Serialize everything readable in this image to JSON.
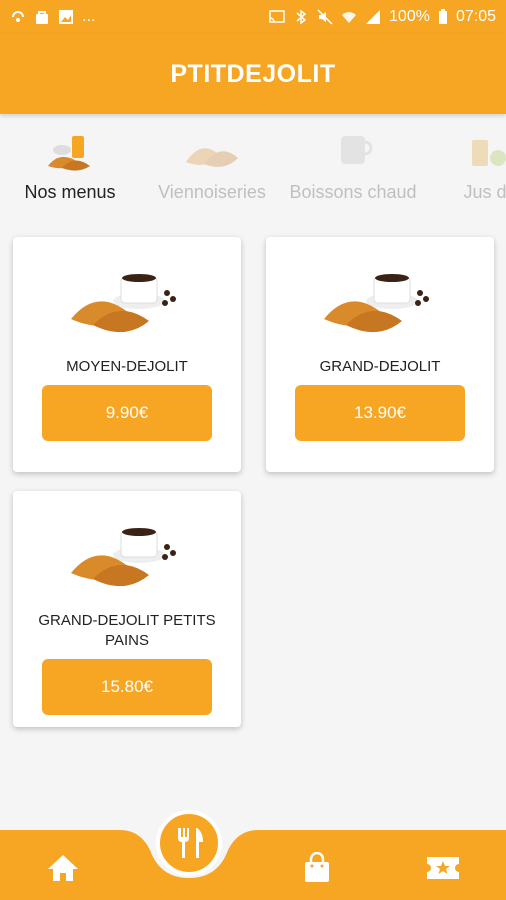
{
  "status_bar": {
    "dots": "...",
    "battery": "100%",
    "time": "07:05"
  },
  "app_title": "PTITDEJOLIT",
  "categories": [
    {
      "label": "Nos menus",
      "icon": "menu-breakfast-icon",
      "active": true
    },
    {
      "label": "Viennoiseries",
      "icon": "pastry-icon",
      "active": false
    },
    {
      "label": "Boissons chaud",
      "icon": "hot-drink-icon",
      "active": false
    },
    {
      "label": "Jus de",
      "icon": "juice-icon",
      "active": false
    }
  ],
  "products": [
    {
      "name": "MOYEN-DEJOLIT",
      "price": "9.90€"
    },
    {
      "name": "GRAND-DEJOLIT",
      "price": "13.90€"
    },
    {
      "name": "GRAND-DEJOLIT PETITS PAINS",
      "price": "15.80€"
    }
  ],
  "bottom_nav": [
    {
      "icon": "home-icon"
    },
    {
      "icon": "fork-knife-icon",
      "active": true
    },
    {
      "icon": "shopping-bag-icon"
    },
    {
      "icon": "ticket-star-icon"
    }
  ],
  "colors": {
    "accent": "#F6A623",
    "background": "#f5f5f5"
  }
}
